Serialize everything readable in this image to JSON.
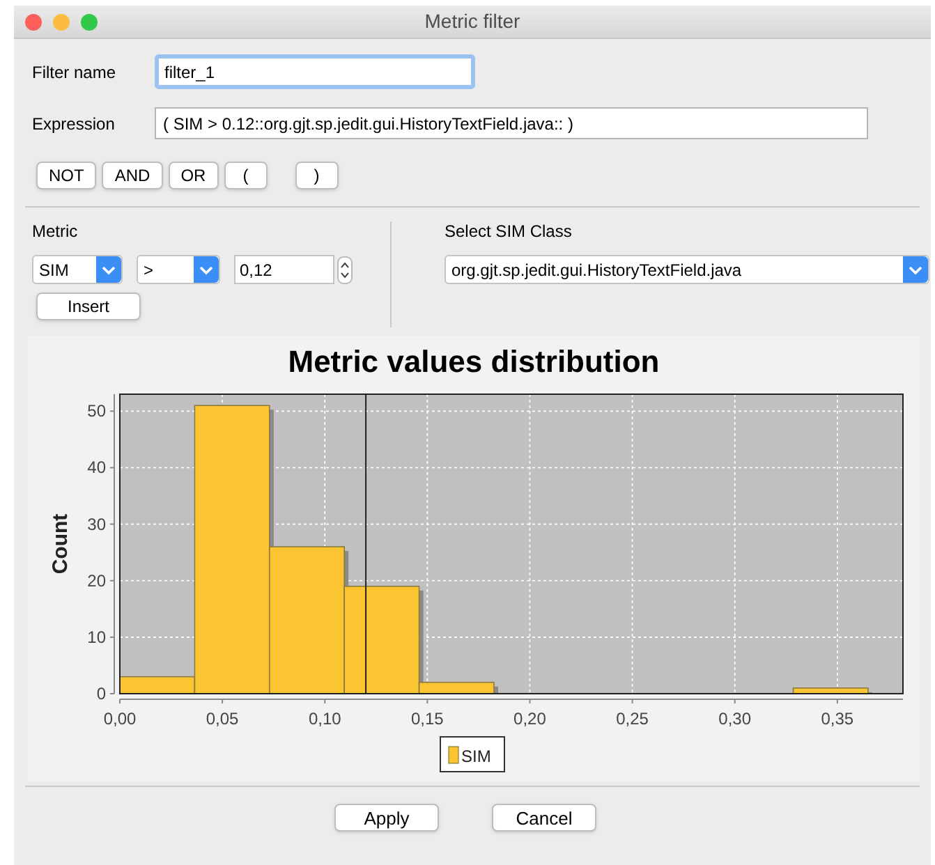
{
  "window": {
    "title": "Metric filter"
  },
  "filter_name": {
    "label": "Filter name",
    "value": "filter_1"
  },
  "expression": {
    "label": "Expression",
    "value": "( SIM > 0.12::org.gjt.sp.jedit.gui.HistoryTextField.java:: )"
  },
  "operators": [
    "NOT",
    "AND",
    "OR",
    "(",
    ")"
  ],
  "metric": {
    "label": "Metric",
    "metric_value": "SIM",
    "operator_value": ">",
    "threshold_value": "0,12",
    "insert_button": "Insert"
  },
  "sim_class": {
    "label": "Select SIM Class",
    "value": "org.gjt.sp.jedit.gui.HistoryTextField.java"
  },
  "chart": {
    "chart_data": {
      "type": "bar",
      "title": "Metric values distribution",
      "ylabel": "Count",
      "x": [
        0.01825,
        0.05475,
        0.09125,
        0.12775,
        0.16425,
        0.20075,
        0.23725,
        0.27375,
        0.31025,
        0.34675
      ],
      "series": [
        {
          "name": "SIM",
          "color": "#fbc531",
          "values": [
            3,
            51,
            26,
            19,
            2,
            0,
            0,
            0,
            0,
            1
          ]
        }
      ],
      "xlim": [
        0,
        0.382
      ],
      "ylim": [
        0,
        53
      ],
      "xticks": [
        {
          "value": 0,
          "label": "0,00"
        },
        {
          "value": 0.05,
          "label": "0,05"
        },
        {
          "value": 0.1,
          "label": "0,10"
        },
        {
          "value": 0.15,
          "label": "0,15"
        },
        {
          "value": 0.2,
          "label": "0,20"
        },
        {
          "value": 0.25,
          "label": "0,25"
        },
        {
          "value": 0.3,
          "label": "0,30"
        },
        {
          "value": 0.35,
          "label": "0,35"
        }
      ],
      "yticks": [
        0,
        10,
        20,
        30,
        40,
        50
      ],
      "grid": true,
      "ref_lines": [
        {
          "axis": "x",
          "value": 0.12
        }
      ]
    }
  },
  "buttons": [
    "Apply",
    "Cancel"
  ]
}
